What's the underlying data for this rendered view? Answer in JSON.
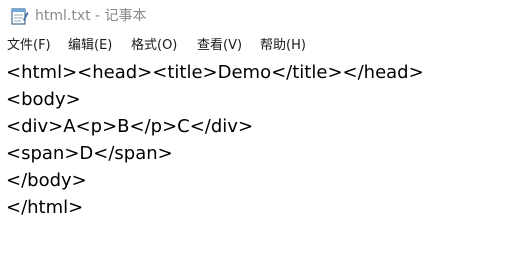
{
  "window": {
    "title": "html.txt - 记事本"
  },
  "menu": {
    "items": [
      {
        "label": "文件(F)"
      },
      {
        "label": "编辑(E)"
      },
      {
        "label": "格式(O)"
      },
      {
        "label": "查看(V)"
      },
      {
        "label": "帮助(H)"
      }
    ]
  },
  "editor": {
    "lines": [
      "<html><head><title>Demo</title></head>",
      "<body>",
      "<div>A<p>B</p>C</div>",
      "<span>D</span>",
      "</body>",
      "</html>"
    ]
  },
  "icons": {
    "app": "notepad-icon"
  },
  "colors": {
    "title_text": "#8a8a8a",
    "menu_text": "#1a1a1a",
    "editor_text": "#000000"
  }
}
